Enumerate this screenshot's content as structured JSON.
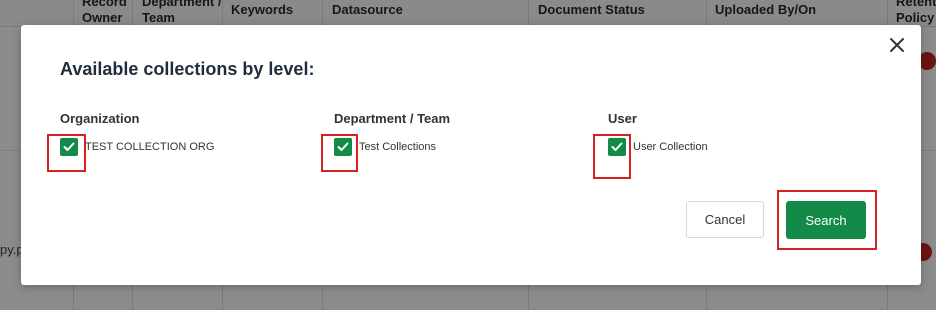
{
  "background_table": {
    "columns": [
      "Record Owner",
      "Department / Team",
      "Keywords",
      "Datasource",
      "Document Status",
      "Uploaded By/On",
      "Retention Policy"
    ],
    "partial_text": "py.p"
  },
  "modal": {
    "title": "Available collections by level:",
    "levels": [
      {
        "heading": "Organization",
        "collection": "TEST COLLECTION ORG",
        "checked": true
      },
      {
        "heading": "Department / Team",
        "collection": "Test Collections",
        "checked": true
      },
      {
        "heading": "User",
        "collection": "User Collection",
        "checked": true
      }
    ],
    "cancel_label": "Cancel",
    "search_label": "Search"
  },
  "colors": {
    "accent_green": "#138a48",
    "highlight_red": "#d42121"
  },
  "icons": {
    "close": "close-icon",
    "check": "check-icon"
  }
}
